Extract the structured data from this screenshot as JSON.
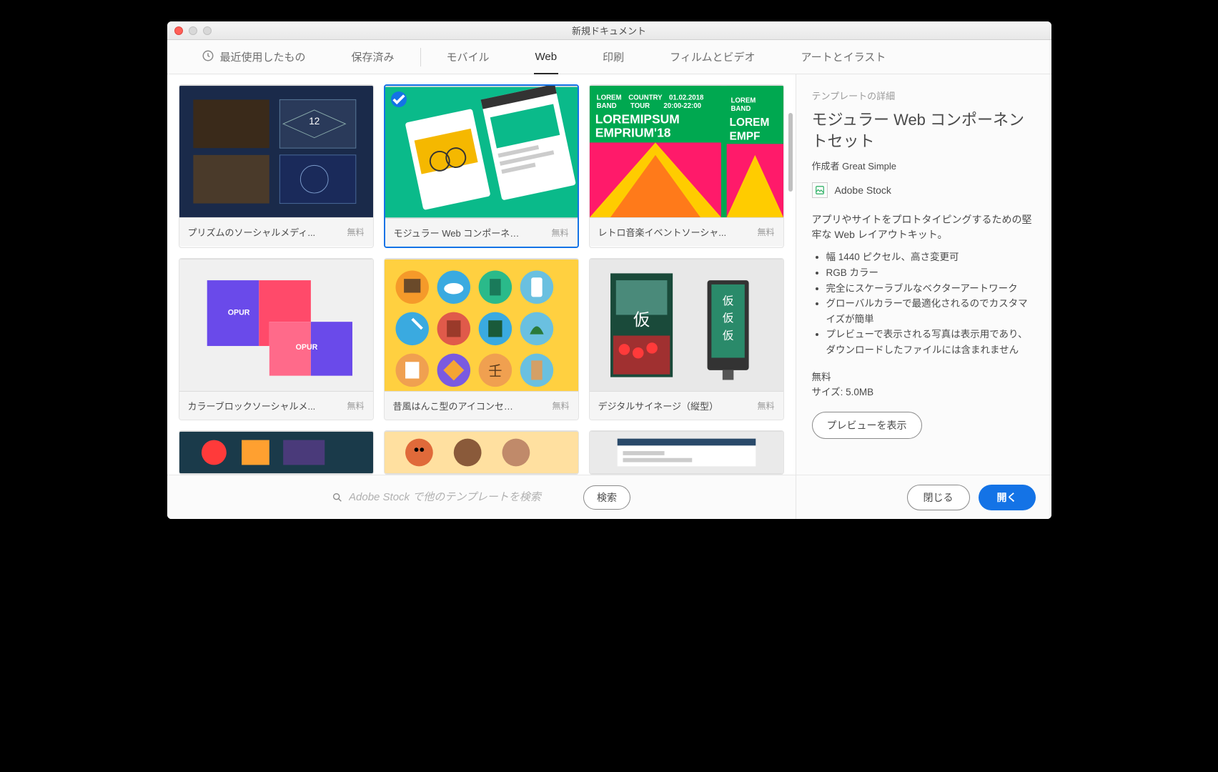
{
  "window": {
    "title": "新規ドキュメント"
  },
  "tabs": {
    "recent": "最近使用したもの",
    "saved": "保存済み",
    "mobile": "モバイル",
    "web": "Web",
    "print": "印刷",
    "film": "フィルムとビデオ",
    "art": "アートとイラスト",
    "active": "web"
  },
  "templates": [
    {
      "name": "プリズムのソーシャルメディ...",
      "price": "無料",
      "thumb": "prism"
    },
    {
      "name": "モジュラー Web コンポーネン...",
      "price": "無料",
      "thumb": "modular",
      "selected": true
    },
    {
      "name": "レトロ音楽イベントソーシャ...",
      "price": "無料",
      "thumb": "retro"
    },
    {
      "name": "カラーブロックソーシャルメ...",
      "price": "無料",
      "thumb": "colorblock"
    },
    {
      "name": "昔風はんこ型のアイコンセット",
      "price": "無料",
      "thumb": "hanko"
    },
    {
      "name": "デジタルサイネージ（縦型）",
      "price": "無料",
      "thumb": "signage"
    }
  ],
  "partial_templates": [
    {
      "thumb": "p1"
    },
    {
      "thumb": "p2"
    },
    {
      "thumb": "p3"
    }
  ],
  "search": {
    "placeholder": "Adobe Stock で他のテンプレートを検索",
    "button": "検索"
  },
  "details": {
    "label": "テンプレートの詳細",
    "title": "モジュラー Web コンポーネントセット",
    "author_prefix": "作成者",
    "author": "Great Simple",
    "stock": "Adobe Stock",
    "description": "アプリやサイトをプロトタイピングするための堅牢な Web レイアウトキット。",
    "features": [
      "幅 1440 ピクセル、高さ変更可",
      "RGB カラー",
      "完全にスケーラブルなベクターアートワーク",
      "グローバルカラーで最適化されるのでカスタマイズが簡単",
      "プレビューで表示される写真は表示用であり、ダウンロードしたファイルには含まれません"
    ],
    "price": "無料",
    "size_label": "サイズ:",
    "size": "5.0MB",
    "preview_button": "プレビューを表示"
  },
  "footer": {
    "close": "閉じる",
    "open": "開く"
  },
  "colors": {
    "accent": "#1473e6"
  }
}
